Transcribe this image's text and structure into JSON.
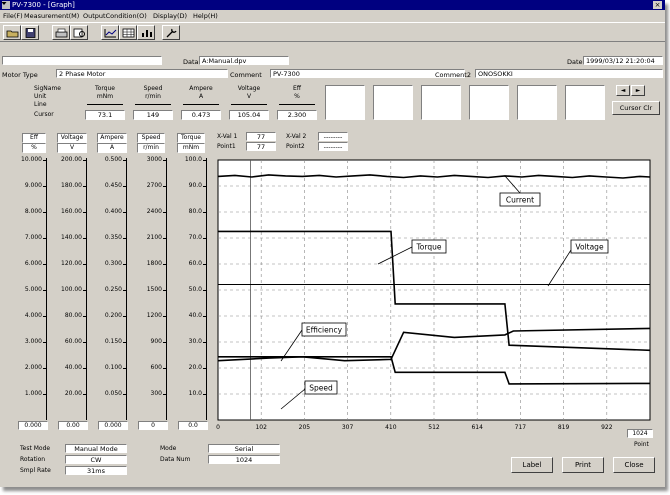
{
  "window": {
    "title": "PV-7300 - [Graph]"
  },
  "menu": [
    "File(F)",
    "Measurement(M)",
    "OutputCondition(O)",
    "Display(D)",
    "Help(H)"
  ],
  "toolbar_icons": [
    "open-file-icon",
    "save-icon",
    "print-icon",
    "print-preview-icon",
    "graph-icon",
    "table-icon",
    "chart-icon",
    "tool-icon"
  ],
  "header": {
    "data_label": "Data",
    "data_file": "A:Manual.dpv",
    "date_label": "Date",
    "date_value": "1999/03/12 21:20:04",
    "motor_type_label": "Motor Type",
    "motor_type_value": "2 Phase Motor",
    "comment_label": "Comment",
    "comment_value": "PV-7300",
    "comment2_label": "Comment2",
    "comment2_value": "ONOSOKKI"
  },
  "signal_table": {
    "row_labels": [
      "SigName",
      "Unit",
      "Line",
      "Cursor"
    ],
    "columns": [
      {
        "name": "Torque",
        "unit": "mNm",
        "cursor": "73.1"
      },
      {
        "name": "Speed",
        "unit": "r/min",
        "cursor": "149"
      },
      {
        "name": "Ampere",
        "unit": "A",
        "cursor": "0.473"
      },
      {
        "name": "Voltage",
        "unit": "V",
        "cursor": "105.04"
      },
      {
        "name": "Eff",
        "unit": "%",
        "cursor": "2.300"
      }
    ],
    "cursor_clr_label": "Cursor Clr",
    "nav_prev": "◄",
    "nav_next": "►"
  },
  "xval": {
    "xval1_label": "X-Val 1",
    "xval1_value": "77",
    "point1_label": "Point1",
    "point1_value": "77",
    "xval2_label": "X-Val 2",
    "xval2_value": "--------",
    "point2_label": "Point2",
    "point2_value": "--------"
  },
  "axes": [
    {
      "name": "Eff",
      "unit": "%",
      "ticks": [
        "10.000",
        "9.000",
        "8.000",
        "7.000",
        "6.000",
        "5.000",
        "4.000",
        "3.000",
        "2.000",
        "1.000"
      ],
      "bottom": "0.000"
    },
    {
      "name": "Voltage",
      "unit": "V",
      "ticks": [
        "200.00",
        "180.00",
        "160.00",
        "140.00",
        "120.00",
        "100.00",
        "80.00",
        "60.00",
        "40.00",
        "20.00"
      ],
      "bottom": "0.00"
    },
    {
      "name": "Ampere",
      "unit": "A",
      "ticks": [
        "0.500",
        "0.450",
        "0.400",
        "0.350",
        "0.300",
        "0.250",
        "0.200",
        "0.150",
        "0.100",
        "0.050"
      ],
      "bottom": "0.000"
    },
    {
      "name": "Speed",
      "unit": "r/min",
      "ticks": [
        "3000",
        "2700",
        "2400",
        "2100",
        "1800",
        "1500",
        "1200",
        "900",
        "600",
        "300"
      ],
      "bottom": "0"
    },
    {
      "name": "Torque",
      "unit": "mNm",
      "ticks": [
        "100.0",
        "90.0",
        "80.0",
        "70.0",
        "60.0",
        "50.0",
        "40.0",
        "30.0",
        "20.0",
        "10.0"
      ],
      "bottom": "0.0"
    }
  ],
  "chart_data": {
    "type": "line",
    "x_ticks": [
      "0",
      "102",
      "205",
      "307",
      "410",
      "512",
      "614",
      "717",
      "819",
      "922",
      "1024"
    ],
    "xlim": [
      0,
      1024
    ],
    "x_unit": "Point",
    "cursor_x": 77,
    "grid": true,
    "series": [
      {
        "name": "Current",
        "axis": "Ampere",
        "x": [
          0,
          40,
          80,
          120,
          160,
          200,
          240,
          280,
          320,
          360,
          400,
          440,
          480,
          520,
          560,
          600,
          640,
          680,
          720,
          760,
          800,
          840,
          880,
          920,
          960,
          1000,
          1024
        ],
        "y": [
          0.472,
          0.474,
          0.471,
          0.475,
          0.473,
          0.472,
          0.474,
          0.471,
          0.473,
          0.475,
          0.472,
          0.47,
          0.473,
          0.471,
          0.474,
          0.472,
          0.47,
          0.473,
          0.471,
          0.474,
          0.472,
          0.47,
          0.473,
          0.471,
          0.469,
          0.472,
          0.471
        ]
      },
      {
        "name": "Torque",
        "axis": "Torque",
        "x": [
          0,
          410,
          420,
          680,
          690,
          1024
        ],
        "y": [
          73.1,
          73.1,
          45.0,
          45.0,
          29.0,
          27.0
        ]
      },
      {
        "name": "Voltage",
        "axis": "Voltage",
        "x": [
          0,
          1024
        ],
        "y": [
          105.0,
          105.0
        ]
      },
      {
        "name": "Efficiency",
        "axis": "Eff",
        "x": [
          0,
          120,
          200,
          300,
          410,
          440,
          560,
          680,
          700,
          1024
        ],
        "y": [
          2.3,
          2.4,
          2.45,
          2.3,
          2.35,
          3.4,
          3.2,
          3.3,
          3.45,
          3.55
        ]
      },
      {
        "name": "Speed",
        "axis": "Speed",
        "x": [
          0,
          410,
          420,
          680,
          690,
          1024
        ],
        "y": [
          735,
          735,
          555,
          555,
          420,
          425
        ]
      }
    ],
    "annotations": [
      "Current",
      "Torque",
      "Voltage",
      "Efficiency",
      "Speed"
    ],
    "x_right_box": "1024"
  },
  "footer": {
    "test_mode_label": "Test Mode",
    "test_mode_value": "Manual Mode",
    "rotation_label": "Rotation",
    "rotation_value": "CW",
    "smpl_rate_label": "Smpl Rate",
    "smpl_rate_value": "31ms",
    "mode_label": "Mode",
    "mode_value": "Serial",
    "data_num_label": "Data Num",
    "data_num_value": "1024",
    "label_button": "Label",
    "print_button": "Print",
    "close_button": "Close"
  }
}
